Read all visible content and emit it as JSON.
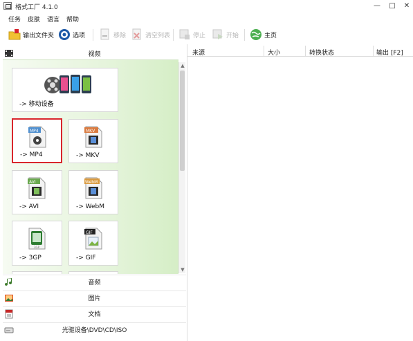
{
  "window": {
    "title": "格式工厂 4.1.0",
    "minimize": "—",
    "maximize": "□",
    "close": "✕"
  },
  "menu": [
    "任务",
    "皮肤",
    "语言",
    "帮助"
  ],
  "toolbar": {
    "output_folder": "输出文件夹",
    "options": "选项",
    "remove": "移除",
    "clear_list": "清空列表",
    "stop": "停止",
    "start": "开始",
    "home": "主页"
  },
  "sections": {
    "video": "视频",
    "audio": "音频",
    "picture": "图片",
    "document": "文档",
    "optical": "光驱设备\\DVD\\CD\\ISO"
  },
  "tiles": [
    {
      "label": "-> 移动设备",
      "icon": "mobile-devices-icon"
    },
    {
      "label": "-> MP4",
      "icon": "mp4-file-icon",
      "badge": "MP4"
    },
    {
      "label": "-> MKV",
      "icon": "mkv-file-icon",
      "badge": "MKV"
    },
    {
      "label": "-> AVI",
      "icon": "avi-file-icon",
      "badge": "AVI"
    },
    {
      "label": "-> WebM",
      "icon": "webm-file-icon",
      "badge": "WebM"
    },
    {
      "label": "-> 3GP",
      "icon": "3gp-file-icon",
      "badge": "3GP"
    },
    {
      "label": "-> GIF",
      "icon": "gif-file-icon",
      "badge": "GIF"
    }
  ],
  "columns": [
    "来源",
    "大小",
    "转换状态",
    "输出 [F2]"
  ],
  "colors": {
    "selection": "#d9262c",
    "panel_green": "#d5eec6"
  }
}
